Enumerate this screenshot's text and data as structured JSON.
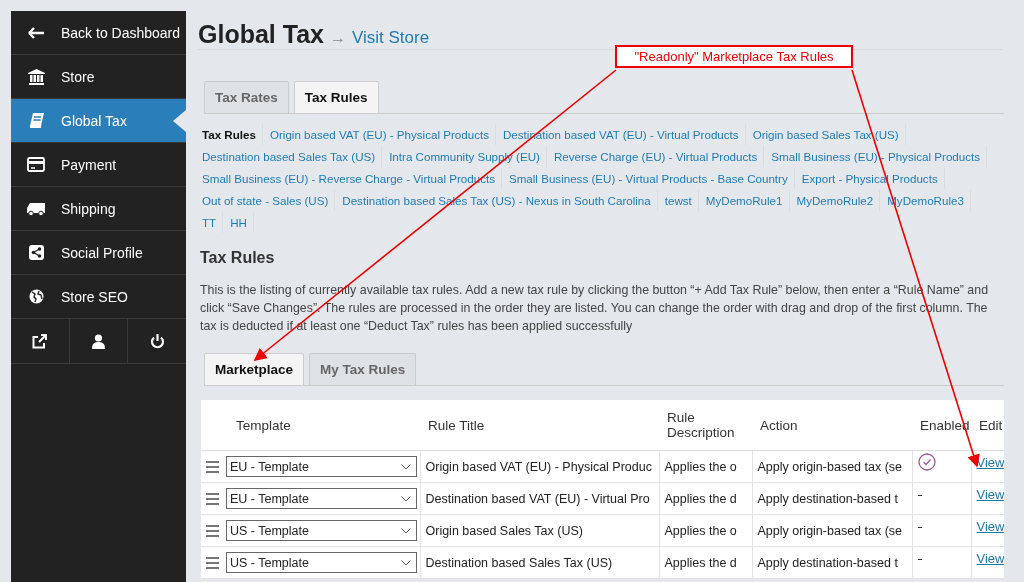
{
  "sidebar": {
    "items": [
      {
        "label": "Back to Dashboard",
        "selected": false
      },
      {
        "label": "Store",
        "selected": false
      },
      {
        "label": "Global Tax",
        "selected": true
      },
      {
        "label": "Payment",
        "selected": false
      },
      {
        "label": "Shipping",
        "selected": false
      },
      {
        "label": "Social Profile",
        "selected": false
      },
      {
        "label": "Store SEO",
        "selected": false
      }
    ]
  },
  "header": {
    "title": "Global Tax",
    "separator": "→",
    "link": "Visit Store"
  },
  "tabs": [
    {
      "label": "Tax Rates",
      "selected": false
    },
    {
      "label": "Tax Rules",
      "selected": true
    }
  ],
  "rule_links": [
    {
      "label": "Tax Rules",
      "selected": true
    },
    {
      "label": "Origin based VAT (EU) - Physical Products",
      "selected": false
    },
    {
      "label": "Destination based VAT (EU) - Virtual Products",
      "selected": false
    },
    {
      "label": "Origin based Sales Tax (US)",
      "selected": false
    },
    {
      "label": "Destination based Sales Tax (US)",
      "selected": false
    },
    {
      "label": "Intra Community Supply (EU)",
      "selected": false
    },
    {
      "label": "Reverse Charge (EU) - Virtual Products",
      "selected": false
    },
    {
      "label": "Small Business (EU) - Physical Products",
      "selected": false
    },
    {
      "label": "Small Business (EU) - Reverse Charge - Virtual Products",
      "selected": false
    },
    {
      "label": "Small Business (EU) - Virtual Products - Base Country",
      "selected": false
    },
    {
      "label": "Export - Physical Products",
      "selected": false
    },
    {
      "label": "Out of state - Sales (US)",
      "selected": false
    },
    {
      "label": "Destination based Sales Tax (US) - Nexus in South Carolina",
      "selected": false
    },
    {
      "label": "tewst",
      "selected": false
    },
    {
      "label": "MyDemoRule1",
      "selected": false
    },
    {
      "label": "MyDemoRule2",
      "selected": false
    },
    {
      "label": "MyDemoRule3",
      "selected": false
    },
    {
      "label": "TT",
      "selected": false
    },
    {
      "label": "HH",
      "selected": false
    }
  ],
  "section": {
    "heading": "Tax Rules",
    "description": "This is the listing of currently available tax rules. Add a new tax rule by clicking the button “+ Add Tax Rule” below, then enter a “Rule Name” and click “Save Changes”. The rules are processed in the order they are listed. You can change the order with drag and drop of the first column. The tax is deducted if at least one “Deduct Tax” rules has been applied successfully"
  },
  "sub_tabs": [
    {
      "label": "Marketplace",
      "selected": true
    },
    {
      "label": "My Tax Rules",
      "selected": false
    }
  ],
  "table": {
    "columns": [
      "Template",
      "Rule Title",
      "Rule Description",
      "Action",
      "Enabled",
      "Edit"
    ],
    "rows": [
      {
        "template": "EU - Template",
        "title": "Origin based VAT (EU) - Physical Produc",
        "description": "Applies the o",
        "action": "Apply origin-based tax (se",
        "enabled": true,
        "edit": "View"
      },
      {
        "template": "EU - Template",
        "title": "Destination based VAT (EU) - Virtual Pro",
        "description": "Applies the d",
        "action": "Apply destination-based t",
        "enabled": false,
        "edit": "View"
      },
      {
        "template": "US - Template",
        "title": "Origin based Sales Tax (US)",
        "description": "Applies the o",
        "action": "Apply origin-based tax (se",
        "enabled": false,
        "edit": "View"
      },
      {
        "template": "US - Template",
        "title": "Destination based Sales Tax (US)",
        "description": "Applies the d",
        "action": "Apply destination-based t",
        "enabled": false,
        "edit": "View"
      }
    ]
  },
  "annotation": {
    "label": "\"Readonly\" Marketplace Tax Rules"
  }
}
